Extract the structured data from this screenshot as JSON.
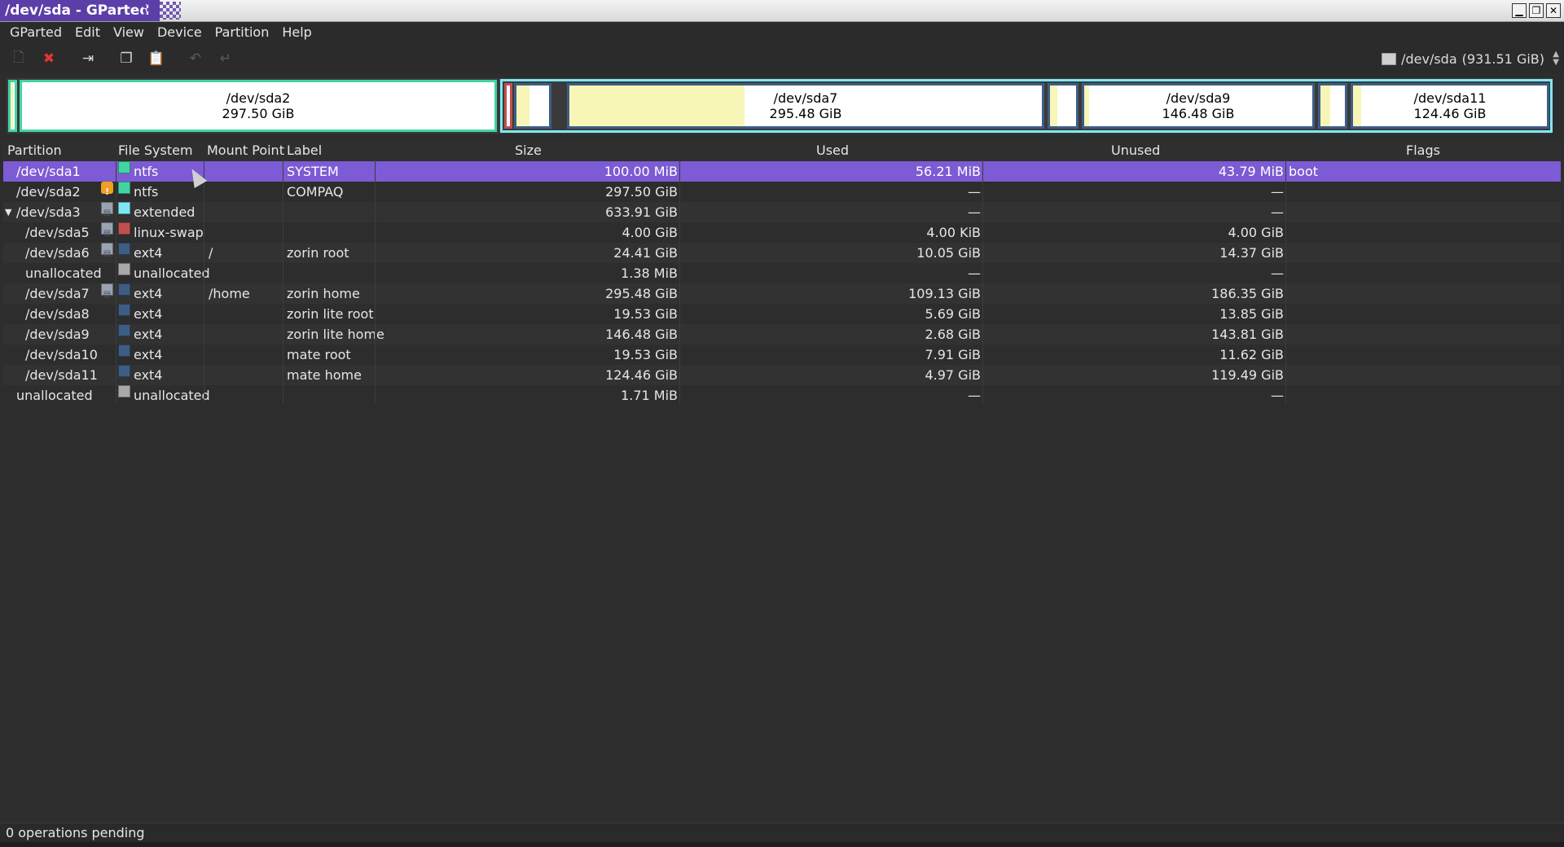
{
  "window": {
    "title": "/dev/sda - GParted"
  },
  "menu": [
    "GParted",
    "Edit",
    "View",
    "Device",
    "Partition",
    "Help"
  ],
  "toolbar": {
    "icons": [
      "new-icon",
      "delete-icon",
      "resize-move-icon",
      "copy-icon",
      "paste-icon",
      "undo-icon",
      "apply-icon"
    ],
    "device": "/dev/sda",
    "device_size": "(931.51 GiB)"
  },
  "graph": {
    "sda2": {
      "name": "/dev/sda2",
      "size": "297.50 GiB"
    },
    "sda7": {
      "name": "/dev/sda7",
      "size": "295.48 GiB"
    },
    "sda9": {
      "name": "/dev/sda9",
      "size": "146.48 GiB"
    },
    "sda11": {
      "name": "/dev/sda11",
      "size": "124.46 GiB"
    }
  },
  "columns": {
    "partition": "Partition",
    "filesystem": "File System",
    "mount": "Mount Point",
    "label": "Label",
    "size": "Size",
    "used": "Used",
    "unused": "Unused",
    "flags": "Flags"
  },
  "rows": [
    {
      "partition": "/dev/sda1",
      "fs": "ntfs",
      "fs_color": "#42d4a4",
      "mount": "",
      "label": "SYSTEM",
      "size": "100.00 MiB",
      "used": "56.21 MiB",
      "unused": "43.79 MiB",
      "flags": "boot"
    },
    {
      "partition": "/dev/sda2",
      "fs": "ntfs",
      "fs_color": "#42d4a4",
      "mount": "",
      "label": "COMPAQ",
      "size": "297.50 GiB",
      "used": "—",
      "unused": "—",
      "flags": ""
    },
    {
      "partition": "/dev/sda3",
      "fs": "extended",
      "fs_color": "#7de8f4",
      "mount": "",
      "label": "",
      "size": "633.91 GiB",
      "used": "—",
      "unused": "—",
      "flags": ""
    },
    {
      "partition": "/dev/sda5",
      "fs": "linux-swap",
      "fs_color": "#c0504d",
      "mount": "",
      "label": "",
      "size": "4.00 GiB",
      "used": "4.00 KiB",
      "unused": "4.00 GiB",
      "flags": ""
    },
    {
      "partition": "/dev/sda6",
      "fs": "ext4",
      "fs_color": "#3e5d84",
      "mount": "/",
      "label": "zorin root",
      "size": "24.41 GiB",
      "used": "10.05 GiB",
      "unused": "14.37 GiB",
      "flags": ""
    },
    {
      "partition": "unallocated",
      "fs": "unallocated",
      "fs_color": "#a9a9a9",
      "mount": "",
      "label": "",
      "size": "1.38 MiB",
      "used": "—",
      "unused": "—",
      "flags": ""
    },
    {
      "partition": "/dev/sda7",
      "fs": "ext4",
      "fs_color": "#3e5d84",
      "mount": "/home",
      "label": "zorin home",
      "size": "295.48 GiB",
      "used": "109.13 GiB",
      "unused": "186.35 GiB",
      "flags": ""
    },
    {
      "partition": "/dev/sda8",
      "fs": "ext4",
      "fs_color": "#3e5d84",
      "mount": "",
      "label": "zorin lite root",
      "size": "19.53 GiB",
      "used": "5.69 GiB",
      "unused": "13.85 GiB",
      "flags": ""
    },
    {
      "partition": "/dev/sda9",
      "fs": "ext4",
      "fs_color": "#3e5d84",
      "mount": "",
      "label": "zorin lite home",
      "size": "146.48 GiB",
      "used": "2.68 GiB",
      "unused": "143.81 GiB",
      "flags": ""
    },
    {
      "partition": "/dev/sda10",
      "fs": "ext4",
      "fs_color": "#3e5d84",
      "mount": "",
      "label": "mate root",
      "size": "19.53 GiB",
      "used": "7.91 GiB",
      "unused": "11.62 GiB",
      "flags": ""
    },
    {
      "partition": "/dev/sda11",
      "fs": "ext4",
      "fs_color": "#3e5d84",
      "mount": "",
      "label": "mate home",
      "size": "124.46 GiB",
      "used": "4.97 GiB",
      "unused": "119.49 GiB",
      "flags": ""
    },
    {
      "partition": "unallocated",
      "fs": "unallocated",
      "fs_color": "#a9a9a9",
      "mount": "",
      "label": "",
      "size": "1.71 MiB",
      "used": "—",
      "unused": "—",
      "flags": ""
    }
  ],
  "status": {
    "text": "0 operations pending"
  }
}
